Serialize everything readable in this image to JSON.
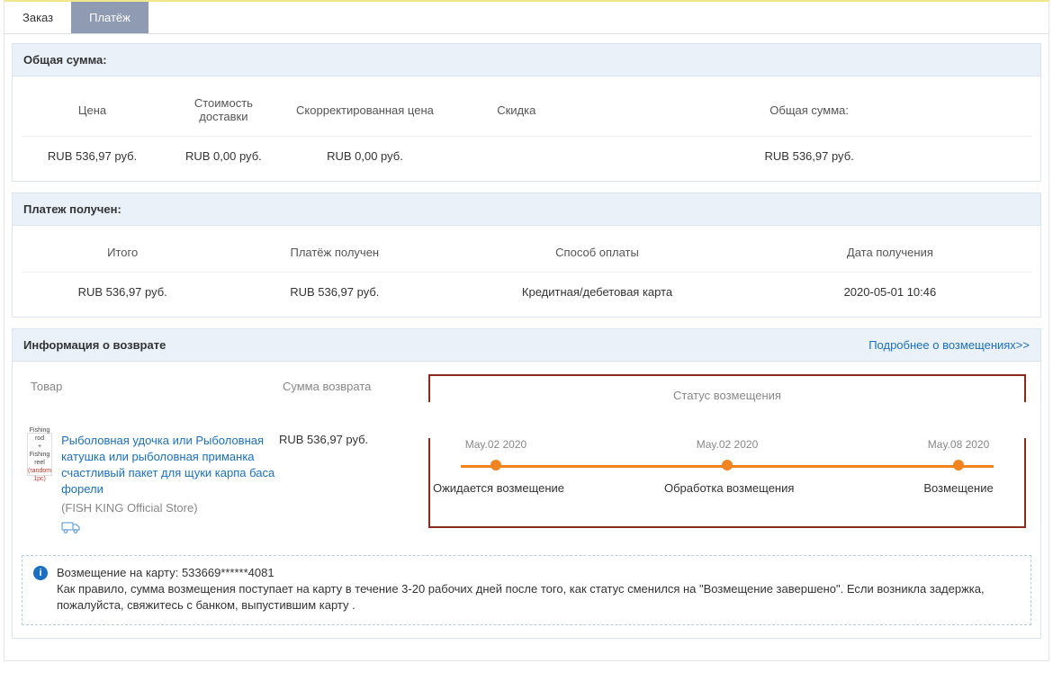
{
  "tabs": {
    "order": "Заказ",
    "payment": "Платёж",
    "active": "payment"
  },
  "total_panel": {
    "title": "Общая сумма:",
    "headers": {
      "price": "Цена",
      "shipping": "Стоимость доставки",
      "adjusted": "Скорректированная цена",
      "discount": "Скидка",
      "total": "Общая сумма:"
    },
    "values": {
      "price": "RUB 536,97 руб.",
      "shipping": "RUB 0,00 руб.",
      "adjusted": "RUB 0,00 руб.",
      "discount": "",
      "total": "RUB 536,97 руб."
    }
  },
  "received_panel": {
    "title": "Платеж получен:",
    "headers": {
      "subtotal": "Итого",
      "received": "Платёж получен",
      "method": "Способ оплаты",
      "date": "Дата получения"
    },
    "values": {
      "subtotal": "RUB 536,97 руб.",
      "received": "RUB 536,97 руб.",
      "method": "Кредитная/дебетовая карта",
      "date": "2020-05-01 10:46"
    }
  },
  "refund_panel": {
    "title": "Информация о возврате",
    "more_link": "Подробнее о возмещениях>>",
    "headers": {
      "product": "Товар",
      "amount": "Сумма возврата",
      "status": "Статус возмещения"
    },
    "product": {
      "title": "Рыболовная удочка или Рыболовная катушка или рыболовная приманка счастливый пакет для щуки карпа баса форели",
      "store": "(FISH KING Official Store)",
      "thumb_line1": "Fishing rod",
      "thumb_plus": "+",
      "thumb_line2": "Fishing reel",
      "thumb_line3": "(random 1pc)"
    },
    "amount": "RUB 536,97 руб.",
    "timeline": [
      {
        "date": "May.02 2020",
        "label": "Ожидается возмещение"
      },
      {
        "date": "May.02 2020",
        "label": "Обработка возмещения"
      },
      {
        "date": "May.08 2020",
        "label": "Возмещение"
      }
    ],
    "info": {
      "line1": "Возмещение на карту: 533669******4081",
      "line2": "Как правило, сумма возмещения поступает на карту в течение 3-20 рабочих дней после того, как статус сменился на \"Возмещение завершено\". Если возникла задержка, пожалуйста, свяжитесь с банком, выпустившим карту ."
    }
  }
}
